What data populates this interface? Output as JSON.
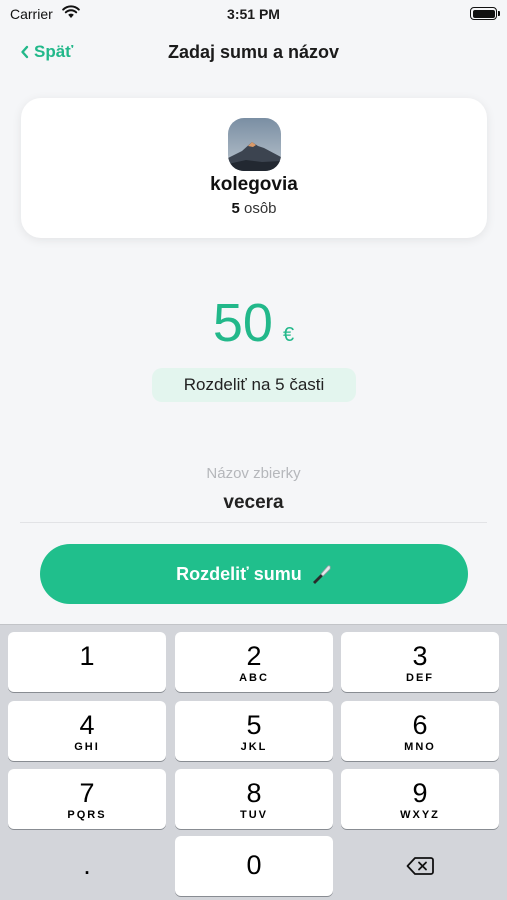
{
  "status": {
    "carrier": "Carrier",
    "time": "3:51 PM"
  },
  "nav": {
    "back_label": "Späť",
    "title": "Zadaj sumu a názov"
  },
  "group": {
    "name": "kolegovia",
    "count": "5",
    "count_unit": "osôb"
  },
  "amount": {
    "value": "50",
    "currency": "€"
  },
  "split_label": "Rozdeliť na 5 časti",
  "collection": {
    "label": "Názov zbierky",
    "value": "vecera"
  },
  "cta": {
    "label": "Rozdeliť sumu"
  },
  "keypad": {
    "k1": {
      "digit": "1",
      "letters": ""
    },
    "k2": {
      "digit": "2",
      "letters": "ABC"
    },
    "k3": {
      "digit": "3",
      "letters": "DEF"
    },
    "k4": {
      "digit": "4",
      "letters": "GHI"
    },
    "k5": {
      "digit": "5",
      "letters": "JKL"
    },
    "k6": {
      "digit": "6",
      "letters": "MNO"
    },
    "k7": {
      "digit": "7",
      "letters": "PQRS"
    },
    "k8": {
      "digit": "8",
      "letters": "TUV"
    },
    "k9": {
      "digit": "9",
      "letters": "WXYZ"
    },
    "k0": {
      "digit": "0"
    },
    "decimal": ".",
    "delete_icon": "backspace-icon"
  },
  "colors": {
    "accent": "#22b88a",
    "button": "#20bf8c",
    "pill": "#e3f5ee"
  }
}
